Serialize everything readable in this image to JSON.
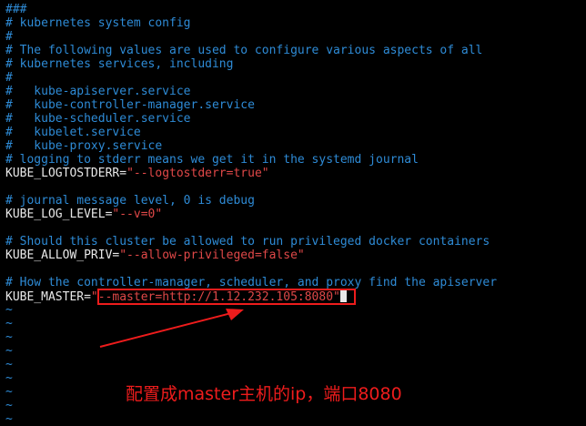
{
  "lines": [
    {
      "type": "comment",
      "text": "###"
    },
    {
      "type": "comment",
      "text": "# kubernetes system config"
    },
    {
      "type": "comment",
      "text": "#"
    },
    {
      "type": "comment",
      "text": "# The following values are used to configure various aspects of all"
    },
    {
      "type": "comment",
      "text": "# kubernetes services, including"
    },
    {
      "type": "comment",
      "text": "#"
    },
    {
      "type": "comment",
      "text": "#   kube-apiserver.service"
    },
    {
      "type": "comment",
      "text": "#   kube-controller-manager.service"
    },
    {
      "type": "comment",
      "text": "#   kube-scheduler.service"
    },
    {
      "type": "comment",
      "text": "#   kubelet.service"
    },
    {
      "type": "comment",
      "text": "#   kube-proxy.service"
    },
    {
      "type": "comment",
      "text": "# logging to stderr means we get it in the systemd journal"
    },
    {
      "type": "setting",
      "key": "KUBE_LOGTOSTDERR=",
      "value": "\"--logtostderr=true\""
    },
    {
      "type": "blank",
      "text": ""
    },
    {
      "type": "comment",
      "text": "# journal message level, 0 is debug"
    },
    {
      "type": "setting",
      "key": "KUBE_LOG_LEVEL=",
      "value": "\"--v=0\""
    },
    {
      "type": "blank",
      "text": ""
    },
    {
      "type": "comment",
      "text": "# Should this cluster be allowed to run privileged docker containers"
    },
    {
      "type": "setting",
      "key": "KUBE_ALLOW_PRIV=",
      "value": "\"--allow-privileged=false\""
    },
    {
      "type": "blank",
      "text": ""
    },
    {
      "type": "comment",
      "text": "# How the controller-manager, scheduler, and proxy find the apiserver"
    },
    {
      "type": "setting",
      "key": "KUBE_MASTER=",
      "value": "\"--master=http://1.12.232.105:8080\"",
      "cursor": true
    },
    {
      "type": "tilde",
      "text": "~"
    },
    {
      "type": "tilde",
      "text": "~"
    },
    {
      "type": "tilde",
      "text": "~"
    },
    {
      "type": "tilde",
      "text": "~"
    },
    {
      "type": "tilde",
      "text": "~"
    },
    {
      "type": "tilde",
      "text": "~"
    },
    {
      "type": "tilde",
      "text": "~"
    },
    {
      "type": "tilde",
      "text": "~"
    },
    {
      "type": "tilde",
      "text": "~"
    }
  ],
  "annotation": {
    "text": "配置成master主机的ip，端口8080",
    "color": "#ee1c1c"
  },
  "colors": {
    "background": "#000000",
    "comment": "#2e8bd6",
    "key": "#e8e8e8",
    "value": "#e04848"
  }
}
